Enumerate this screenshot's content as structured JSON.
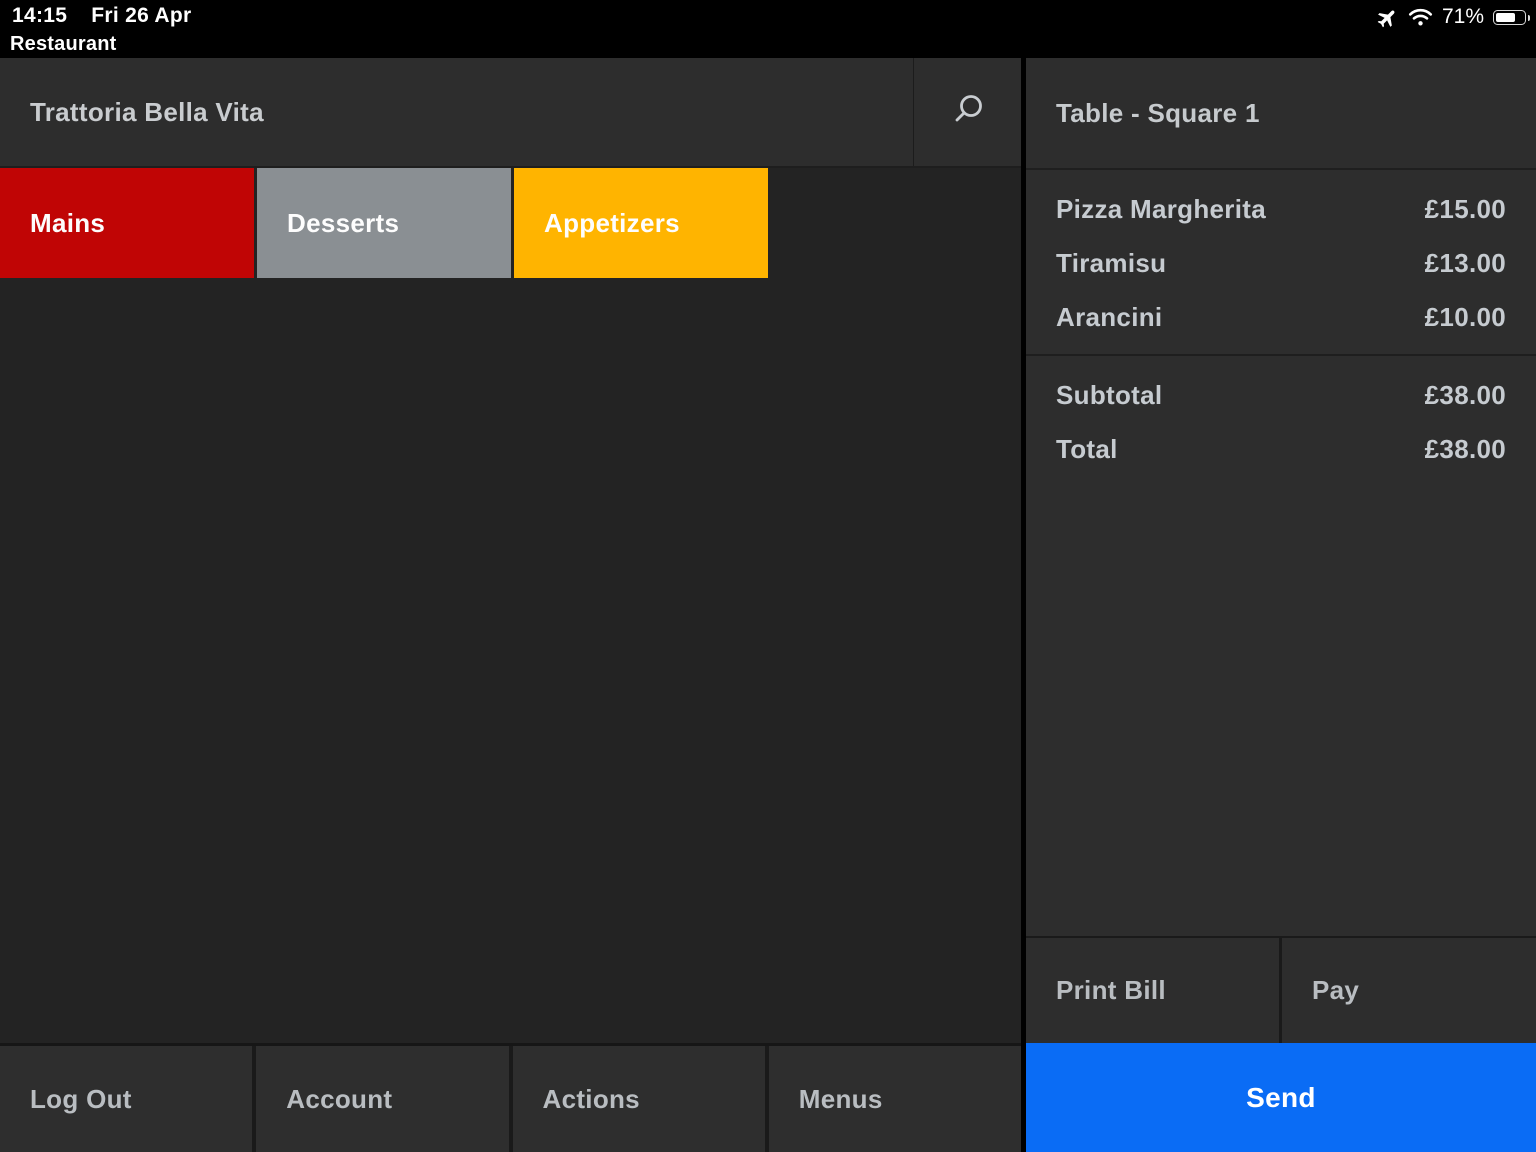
{
  "status_bar": {
    "time": "14:15",
    "date": "Fri 26 Apr",
    "app_name": "Restaurant",
    "battery_percent": "71%",
    "battery_level": 71,
    "icons": [
      "airplane-mode-icon",
      "wifi-icon",
      "battery-icon"
    ]
  },
  "header": {
    "title": "Trattoria Bella Vita",
    "search_icon": "magnifier-icon"
  },
  "categories": [
    {
      "label": "Mains",
      "color": "#c00505"
    },
    {
      "label": "Desserts",
      "color": "#8a8f93"
    },
    {
      "label": "Appetizers",
      "color": "#ffb400"
    }
  ],
  "order_panel": {
    "title": "Table - Square 1",
    "items": [
      {
        "name": "Pizza Margherita",
        "price": "£15.00"
      },
      {
        "name": "Tiramisu",
        "price": "£13.00"
      },
      {
        "name": "Arancini",
        "price": "£10.00"
      }
    ],
    "totals": [
      {
        "label": "Subtotal",
        "amount": "£38.00"
      },
      {
        "label": "Total",
        "amount": "£38.00"
      }
    ],
    "actions": {
      "print_bill": "Print Bill",
      "pay": "Pay"
    },
    "send_label": "Send",
    "send_color": "#0a6cf5"
  },
  "bottom_bar": {
    "items": [
      {
        "label": "Log Out"
      },
      {
        "label": "Account"
      },
      {
        "label": "Actions"
      },
      {
        "label": "Menus"
      }
    ]
  }
}
